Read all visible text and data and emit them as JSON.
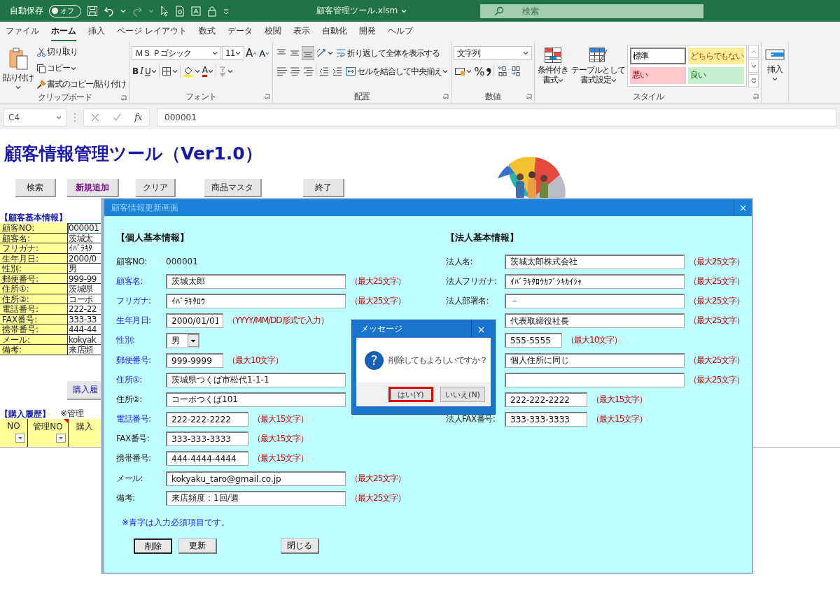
{
  "window": {
    "autosave_label": "自動保存",
    "autosave_toggle": "オフ",
    "autosave_on": false,
    "title": "顧客管理ツール.xlsm",
    "search_placeholder": "検索"
  },
  "ribbon_tabs": [
    {
      "label": "ファイル",
      "selected": false
    },
    {
      "label": "ホーム",
      "selected": true
    },
    {
      "label": "挿入",
      "selected": false
    },
    {
      "label": "ページ レイアウト",
      "selected": false
    },
    {
      "label": "数式",
      "selected": false
    },
    {
      "label": "データ",
      "selected": false
    },
    {
      "label": "校閲",
      "selected": false
    },
    {
      "label": "表示",
      "selected": false
    },
    {
      "label": "自動化",
      "selected": false
    },
    {
      "label": "開発",
      "selected": false
    },
    {
      "label": "ヘルプ",
      "selected": false
    }
  ],
  "clipboard": {
    "paste": "貼り付け",
    "cut": "切り取り",
    "copy": "コピー",
    "format_painter": "書式のコピー/貼り付け",
    "group": "クリップボード"
  },
  "font": {
    "name": "ＭＳ Ｐゴシック",
    "size": "11",
    "grow": "A",
    "shrink": "A",
    "bold": "B",
    "italic": "I",
    "underline": "U",
    "font_color": "A",
    "group": "フォント"
  },
  "alignment": {
    "vertical": [
      {
        "kind": "top",
        "selected": false
      },
      {
        "kind": "middle",
        "selected": false
      },
      {
        "kind": "bottom",
        "selected": true
      }
    ],
    "wrap": "折り返して全体を表示する",
    "merge": "セルを結合して中央揃え",
    "group": "配置"
  },
  "number": {
    "format": "文字列",
    "percent": "%",
    "group": "数値"
  },
  "styles": {
    "conditional": [
      "条件付き",
      "書式"
    ],
    "table": [
      "テーブルとして",
      "書式設定"
    ],
    "gallery": [
      {
        "label": "標準",
        "kind": "normal",
        "color": "#ffffff",
        "selected": true
      },
      {
        "label": "どちらでもない",
        "kind": "neutral",
        "color": "#ffeb9c",
        "selected": false
      },
      {
        "label": "悪い",
        "kind": "bad",
        "color": "#ffc7ce",
        "selected": false
      },
      {
        "label": "良い",
        "kind": "good",
        "color": "#c6efce",
        "selected": false
      }
    ],
    "group": "スタイル"
  },
  "cells": {
    "insert": "挿入"
  },
  "formula_bar": {
    "name_box": "C4",
    "function": "fx",
    "value": "000001"
  },
  "sheet": {
    "title": "顧客情報管理ツール（Ver1.0）",
    "buttons": [
      {
        "label": "検索",
        "highlighted": false
      },
      {
        "label": "新規追加",
        "highlighted": true
      },
      {
        "label": "クリア",
        "highlighted": false
      },
      {
        "label": "商品マスタ",
        "highlighted": false
      },
      {
        "label": "終了",
        "highlighted": false
      }
    ],
    "basic_heading": "【顧客基本情報】",
    "basic_rows": [
      {
        "label": "顧客NO:",
        "value": "000001",
        "active": true
      },
      {
        "label": "顧客名:",
        "value": "茨城太",
        "active": false
      },
      {
        "label": "フリガナ:",
        "value": "ｲﾊﾞﾗｷﾀ",
        "active": false
      },
      {
        "label": "生年月日:",
        "value": "2000/0",
        "active": false
      },
      {
        "label": "性別:",
        "value": "男",
        "active": false
      },
      {
        "label": "郵便番号:",
        "value": "999-99",
        "active": false
      },
      {
        "label": "住所①:",
        "value": "茨城県",
        "active": false
      },
      {
        "label": "住所②:",
        "value": "コーポ",
        "active": false
      },
      {
        "label": "電話番号:",
        "value": "222-22",
        "active": false
      },
      {
        "label": "FAX番号:",
        "value": "333-33",
        "active": false
      },
      {
        "label": "携帯番号:",
        "value": "444-44",
        "active": false
      },
      {
        "label": "メール:",
        "value": "kokyak",
        "active": false
      },
      {
        "label": "備考:",
        "value": "来店頻",
        "active": false
      }
    ],
    "history_button": "購入履",
    "history_heading": "【購入履歴】",
    "history_note": "※管理",
    "history_columns": [
      {
        "label": "NO"
      },
      {
        "label": "管理NO",
        "comment": true
      },
      {
        "label": "購入"
      }
    ]
  },
  "dialog": {
    "title": "顧客情報更新画面",
    "close": "×",
    "personal_heading": "【個人基本情報】",
    "personal_fields": [
      {
        "label": "顧客NO:",
        "kind": "static",
        "value": "000001",
        "required": false
      },
      {
        "label": "顧客名:",
        "kind": "long",
        "value": "茨城太郎",
        "note": "（最大25文字）",
        "required": true
      },
      {
        "label": "フリガナ:",
        "kind": "long",
        "value": "ｲﾊﾞﾗｷﾀﾛｳ",
        "note": "（最大25文字）",
        "required": true
      },
      {
        "label": "生年月日:",
        "kind": "short",
        "value": "2000/01/01",
        "note": "（YYYY/MM/DD形式で入力）",
        "required": true
      },
      {
        "label": "性別:",
        "kind": "select",
        "value": "男",
        "required": true
      },
      {
        "label": "郵便番号:",
        "kind": "short",
        "value": "999-9999",
        "note": "（最大10文字）",
        "required": true
      },
      {
        "label": "住所①:",
        "kind": "long",
        "value": "茨城県つくば市松代1-1-1",
        "required": true
      },
      {
        "label": "住所②:",
        "kind": "long",
        "value": "コーポつくば101",
        "required": false
      },
      {
        "label": "電話番号:",
        "kind": "medium",
        "value": "222-222-2222",
        "note": "（最大15文字）",
        "required": true
      },
      {
        "label": "FAX番号:",
        "kind": "medium",
        "value": "333-333-3333",
        "note": "（最大15文字）",
        "required": false
      },
      {
        "label": "携帯番号:",
        "kind": "medium",
        "value": "444-4444-4444",
        "note": "（最大15文字）",
        "required": false
      },
      {
        "label": "メール:",
        "kind": "long",
        "value": "kokyaku_taro@gmail.co.jp",
        "note": "（最大25文字）",
        "required": false
      },
      {
        "label": "備考:",
        "kind": "long",
        "value": "来店頻度：1回/週",
        "note": "（最大25文字）",
        "required": false
      }
    ],
    "corporate_heading": "【法人基本情報】",
    "corporate_fields": [
      {
        "label": "法人名:",
        "kind": "long",
        "value": "茨城太郎株式会社",
        "note": "（最大25文字）"
      },
      {
        "label": "法人フリガナ:",
        "kind": "long",
        "value": "ｲﾊﾞﾗｷﾀﾛｳｶﾌﾞｼｷｶｲｼｬ",
        "note": "（最大25文字）"
      },
      {
        "label": "法人部署名:",
        "kind": "long",
        "value": "－",
        "note": "（最大25文字）"
      },
      {
        "kind": "long",
        "value": "代表取締役社長",
        "note": "（最大25文字）"
      },
      {
        "kind": "short",
        "value": "555-5555",
        "note": "（最大10文字）"
      },
      {
        "kind": "long",
        "value": "個人住所に同じ",
        "note": "（最大25文字）"
      },
      {
        "kind": "long",
        "note": "（最大25文字）"
      },
      {
        "kind": "medium",
        "value": "222-222-2222",
        "note": "（最大15文字）"
      },
      {
        "label": "法人FAX番号:",
        "kind": "medium",
        "value": "333-333-3333",
        "note": "（最大15文字）"
      }
    ],
    "notice": "※青字は入力必須項目です。",
    "buttons": [
      {
        "label": "削除",
        "focused": true
      },
      {
        "label": "更新",
        "focused": false
      },
      {
        "label": "閉じる",
        "focused": false
      }
    ]
  },
  "message_box": {
    "title": "メッセージ",
    "close": "×",
    "icon": "?",
    "text": "削除してもよろしいですか？",
    "buttons": [
      {
        "label": "はい(Y)",
        "selected": true
      },
      {
        "label": "いいえ(N)",
        "selected": false
      }
    ]
  }
}
